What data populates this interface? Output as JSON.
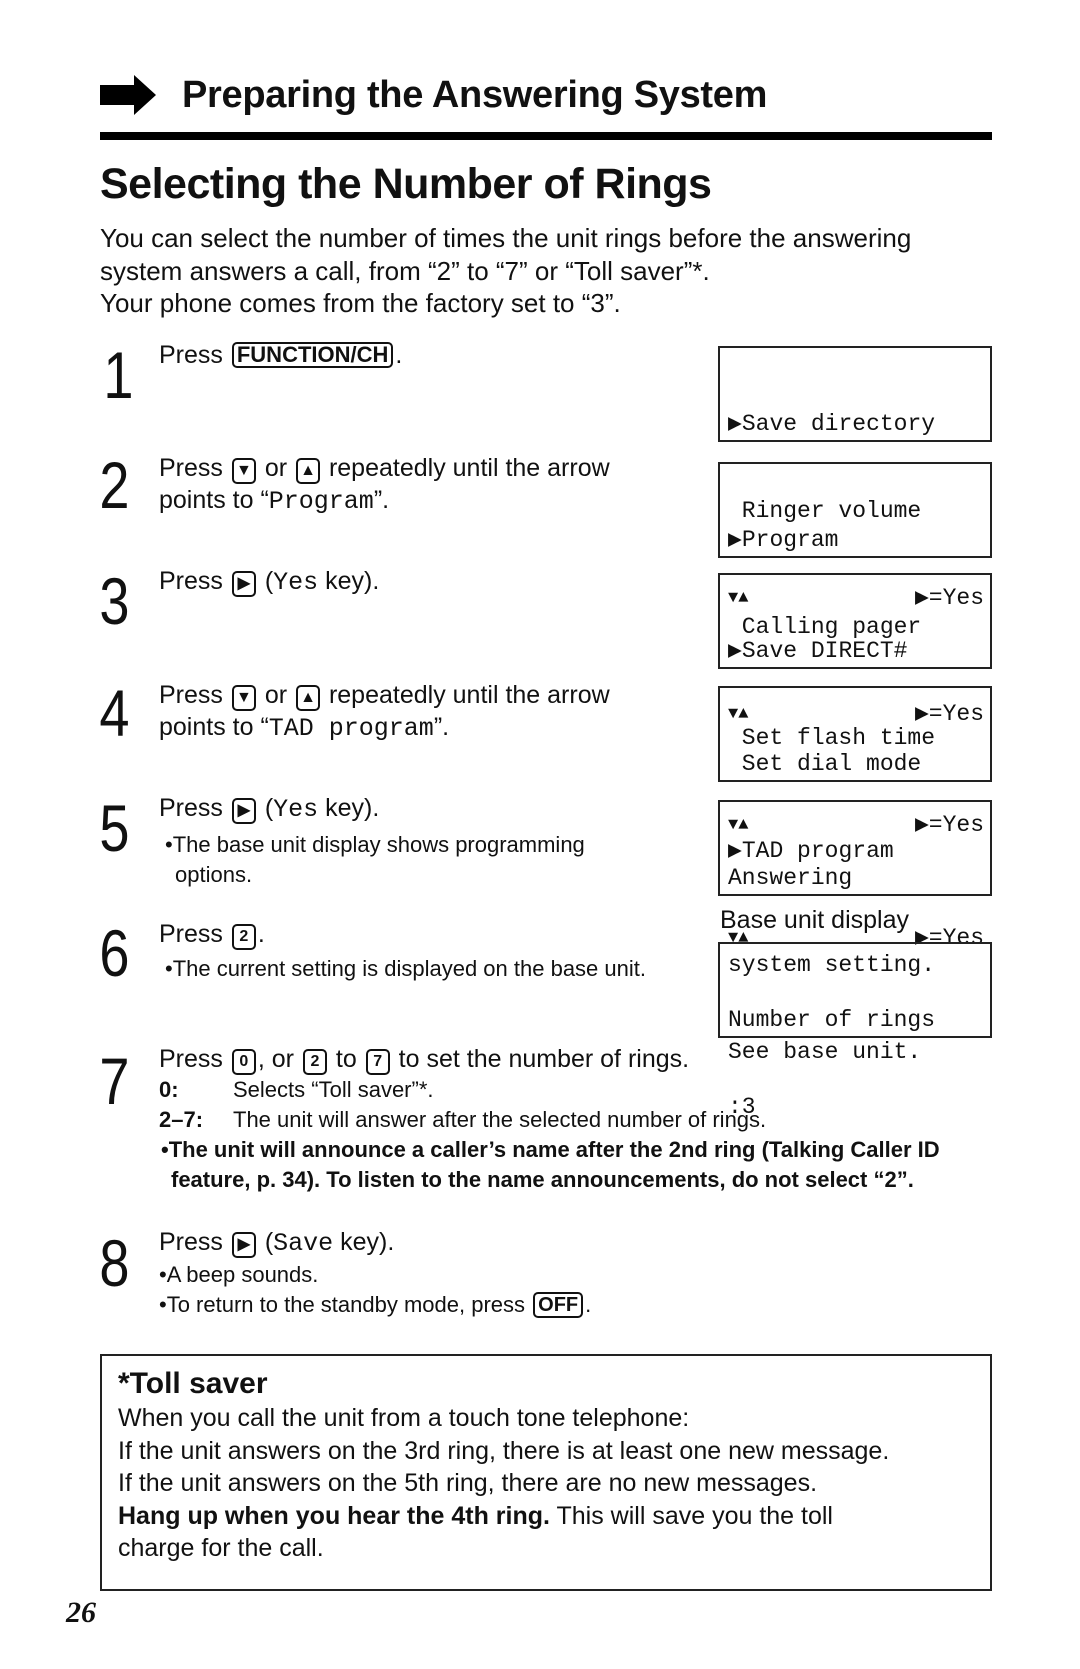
{
  "section": {
    "title": "Preparing the Answering System",
    "icon": "arrow-right-icon"
  },
  "page_title": "Selecting the Number of Rings",
  "intro": [
    "You can select the number of times the unit rings before the answering",
    "system answers a call, from “2” to “7” or “Toll saver”*.",
    "Your phone comes from the factory set to “3”."
  ],
  "steps": [
    {
      "num": "1",
      "pre": "Press",
      "key": "FUNCTION/CH",
      "post": "."
    },
    {
      "num": "2",
      "pre": "Press",
      "key_down": "▼",
      "or": "or",
      "key_up": "▲",
      "post": "repeatedly until the arrow",
      "line2_pre": "points to “",
      "line2_mono": "Program",
      "line2_post": "”."
    },
    {
      "num": "3",
      "pre": "Press",
      "key": "▶",
      "paren_open": "(",
      "mono": "Yes",
      "post": " key)."
    },
    {
      "num": "4",
      "pre": "Press",
      "key_down": "▼",
      "or": "or",
      "key_up": "▲",
      "post": "repeatedly until the arrow",
      "line2_pre": "points to “",
      "line2_mono": "TAD program",
      "line2_post": "”."
    },
    {
      "num": "5",
      "pre": "Press",
      "key": "▶",
      "paren_open": "(",
      "mono": "Yes",
      "post": " key).",
      "bullets": [
        "•The base unit display shows programming options."
      ]
    },
    {
      "num": "6",
      "pre": "Press",
      "key": "2",
      "post": ".",
      "bullets": [
        "•The current setting is displayed on the base unit."
      ]
    },
    {
      "num": "7",
      "pre": "Press",
      "key0": "0",
      "mid1": ", or",
      "key2": "2",
      "mid2": "to",
      "key7": "7",
      "post": "to set the number of rings.",
      "options": [
        {
          "k": "0:",
          "v": "Selects “Toll saver”*."
        },
        {
          "k": "2–7:",
          "v": "The unit will answer after the selected number of rings."
        }
      ],
      "bold_note": "•The unit will announce a caller’s name after the 2nd ring (Talking Caller ID feature, p. 34). To listen to the name announcements, do not select “2”."
    },
    {
      "num": "8",
      "pre": "Press",
      "key": "▶",
      "paren_open": "(",
      "mono": "Save",
      "post": " key).",
      "bullets": [
        "•A beep sounds."
      ],
      "bullet2_pre": "•To return to the standby mode, press",
      "bullet2_key": "OFF",
      "bullet2_post": "."
    }
  ],
  "lcd_screens": [
    {
      "rows": [
        "▶Save directory",
        " Ringer volume"
      ],
      "nav": "▼▲",
      "yes": "▶=Yes"
    },
    {
      "rows": [
        "▶Program",
        " Calling pager"
      ],
      "nav": "▼▲",
      "yes": "▶=Yes"
    },
    {
      "rows": [
        "▶Save DIRECT#",
        " Set flash time"
      ],
      "nav": "▼▲",
      "yes": "▶=Yes"
    },
    {
      "rows": [
        " Set dial mode",
        "▶TAD program"
      ],
      "nav": "▼▲",
      "yes": "▶=Yes"
    },
    {
      "rows": [
        "Answering",
        "system setting.",
        "See base unit."
      ]
    },
    {
      "rows": [
        "Number of rings",
        ":3"
      ]
    }
  ],
  "base_unit_label": "Base unit display",
  "toll_saver": {
    "title": "*Toll saver",
    "lines": [
      "When you call the unit from a touch tone telephone:",
      "If the unit answers on the 3rd ring, there is at least one new message.",
      "If the unit answers on the 5th ring, there are no new messages."
    ],
    "bold": "Hang up when you hear the 4th ring.",
    "rest": " This will save you the toll",
    "last": "charge for the call."
  },
  "page_number": "26"
}
